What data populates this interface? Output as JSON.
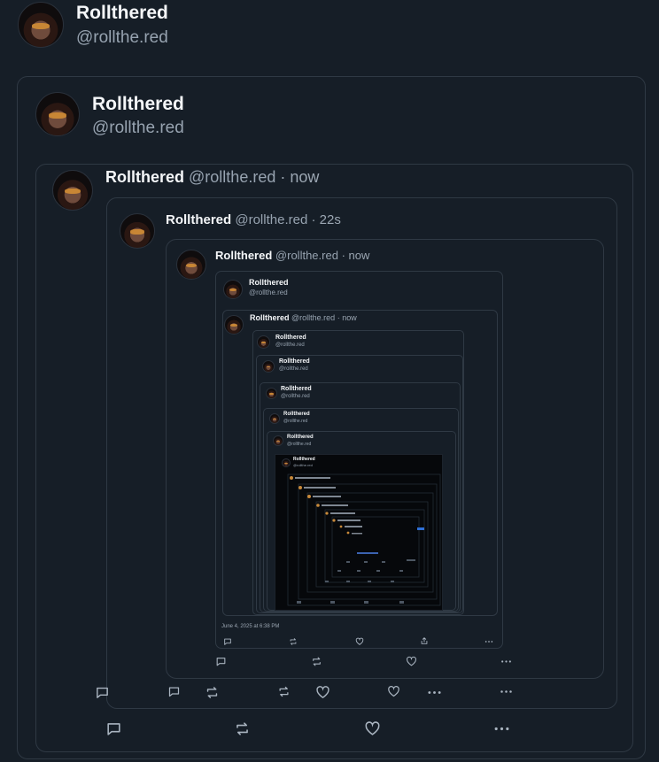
{
  "user": {
    "name": "Rollthered",
    "handle": "@rollthe.red"
  },
  "embeds": {
    "level3": {
      "time": "now"
    },
    "level4": {
      "time": "22s"
    },
    "level5": {
      "time": "now"
    },
    "level6": {
      "time": "now"
    }
  },
  "footer": {
    "date": "June 4, 2025 at 6:38 PM"
  },
  "icons": {
    "reply": "speech-bubble-icon",
    "repost": "repost-arrows-icon",
    "like": "heart-icon",
    "share": "share-icon",
    "more": "more-dots-icon"
  },
  "colors": {
    "background": "#161e27",
    "border": "#2f3944",
    "muted": "#97a3b0"
  }
}
